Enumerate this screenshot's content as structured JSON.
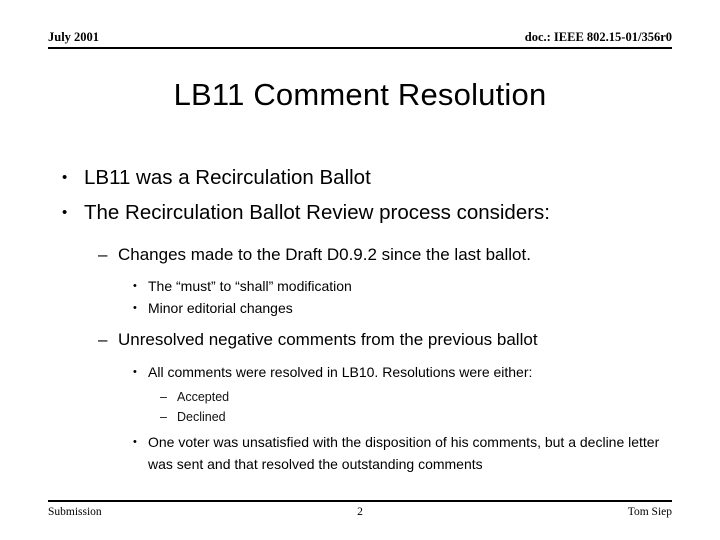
{
  "header": {
    "date": "July 2001",
    "doc_number": "doc.: IEEE 802.15-01/356r0"
  },
  "title": "LB11 Comment Resolution",
  "markers": {
    "level1": "•",
    "level2": "–",
    "level3": "•",
    "level4": "–"
  },
  "bullets": [
    {
      "level": 1,
      "text": "LB11 was a Recirculation Ballot"
    },
    {
      "level": 1,
      "text": "The Recirculation Ballot Review process considers:"
    },
    {
      "level": 2,
      "text": "Changes made to the Draft D0.9.2 since the last ballot."
    },
    {
      "level": 3,
      "text": "The “must” to “shall” modification"
    },
    {
      "level": 3,
      "text": "Minor editorial changes"
    },
    {
      "level": 2,
      "text": "Unresolved negative comments from the previous ballot"
    },
    {
      "level": 3,
      "text": "All comments were resolved in LB10.  Resolutions were either:"
    },
    {
      "level": 4,
      "text": "Accepted"
    },
    {
      "level": 4,
      "text": "Declined"
    },
    {
      "level": 3,
      "text": "One voter was unsatisfied with the disposition of his comments, but a decline letter was sent and that resolved the outstanding comments"
    }
  ],
  "footer": {
    "left": "Submission",
    "page_number": "2",
    "right": "Tom Siep"
  }
}
